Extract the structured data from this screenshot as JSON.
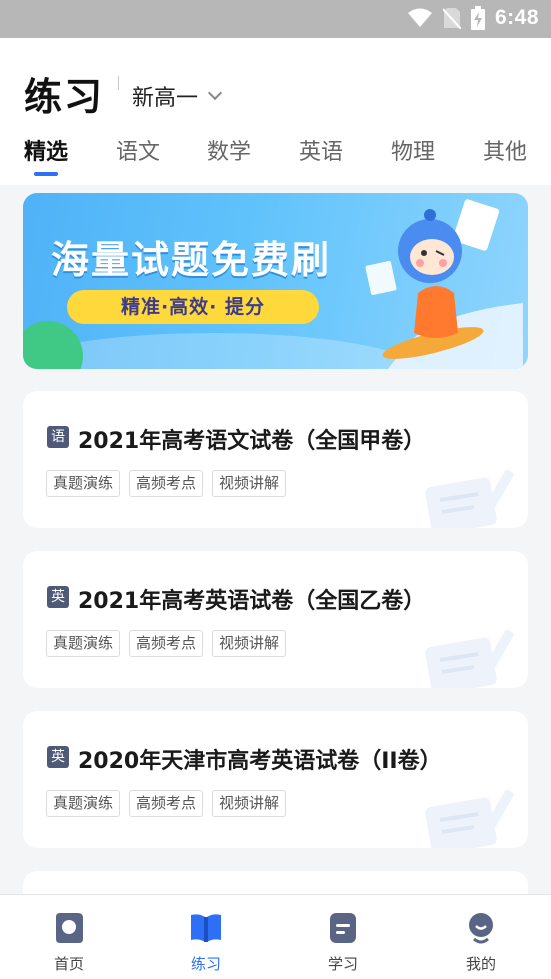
{
  "status_bar": {
    "time": "6:48"
  },
  "header": {
    "title": "练习",
    "grade": "新高一"
  },
  "tabs": [
    {
      "label": "精选",
      "active": true
    },
    {
      "label": "语文"
    },
    {
      "label": "数学"
    },
    {
      "label": "英语"
    },
    {
      "label": "物理"
    },
    {
      "label": "其他"
    }
  ],
  "banner": {
    "headline": "海量试题免费刷",
    "pill": "精准·高效· 提分"
  },
  "papers": [
    {
      "subject": "语",
      "title": "2021年高考语文试卷（全国甲卷）",
      "tags": [
        "真题演练",
        "高频考点",
        "视频讲解"
      ]
    },
    {
      "subject": "英",
      "title": "2021年高考英语试卷（全国乙卷）",
      "tags": [
        "真题演练",
        "高频考点",
        "视频讲解"
      ]
    },
    {
      "subject": "英",
      "title": "2020年天津市高考英语试卷（II卷）",
      "tags": [
        "真题演练",
        "高频考点",
        "视频讲解"
      ]
    }
  ],
  "bottom_nav": [
    {
      "label": "首页",
      "icon": "home-icon"
    },
    {
      "label": "练习",
      "icon": "practice-book-icon",
      "active": true
    },
    {
      "label": "学习",
      "icon": "study-doc-icon"
    },
    {
      "label": "我的",
      "icon": "profile-icon"
    }
  ],
  "colors": {
    "accent": "#2d6ff6",
    "subject_badge": "#4e5a78",
    "banner_pill": "#ffd93b"
  }
}
